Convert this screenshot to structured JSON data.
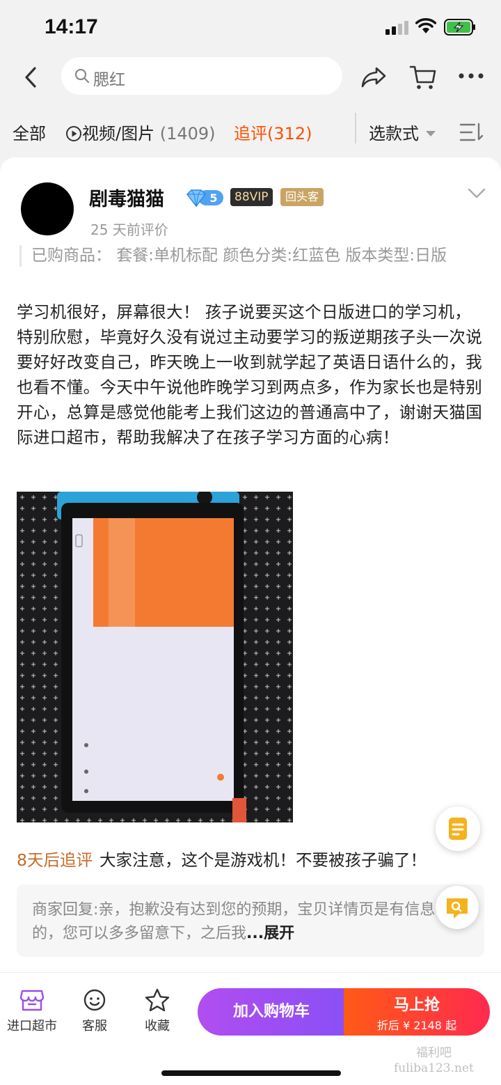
{
  "status_bar": {
    "time": "14:17"
  },
  "search": {
    "query": "腮红"
  },
  "tabs": {
    "all": "全部",
    "media": {
      "label": "视频/图片",
      "count": "(1409)"
    },
    "followup": {
      "label": "追评",
      "count": "(312)"
    },
    "style_select": "选款式"
  },
  "review": {
    "username": "剧毒猫猫",
    "level": "5",
    "vip_badge": "88VIP",
    "repeat_badge": "回头客",
    "date": "25 天前评价",
    "purchased": "已购商品：  套餐:单机标配    颜色分类:红蓝色    版本类型:日版",
    "text": "学习机很好，屏幕很大！ 孩子说要买这个日版进口的学习机，特别欣慰，毕竟好久没有说过主动要学习的叛逆期孩子头一次说要好好改变自己，昨天晚上一收到就学起了英语日语什么的，我也看不懂。今天中午说他昨晚学习到两点多，作为家长也是特别开心，总算是感觉他能考上我们这边的普通高中了，谢谢天猫国际进口超市，帮助我解决了在孩子学习方面的心病！",
    "followup_label": "8天后追评",
    "followup_text": "大家注意，这个是游戏机！不要被孩子骗了！",
    "seller_reply": "商家回复:亲，抱歉没有达到您的预期，宝贝详情页是有信息说明的，您可以多多留意下，之后我",
    "reply_more": "...展开"
  },
  "bottom_bar": {
    "store": "进口超市",
    "service": "客服",
    "favorite": "收藏",
    "add_to_cart": "加入购物车",
    "buy_now": "马上抢",
    "price": "折后 ¥ 2148 起"
  },
  "watermark": {
    "line1": "福利吧",
    "line2": "fuliba123.net"
  },
  "colors": {
    "accent": "#ff5000",
    "purple": "#9b4ef2",
    "red": "#ff2a4f",
    "followup_orange": "#c76a2a"
  }
}
